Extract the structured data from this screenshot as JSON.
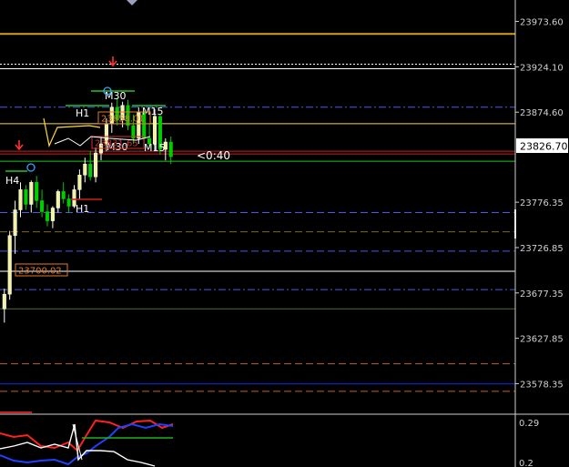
{
  "chart_data": [
    {
      "type": "candlestick",
      "title": "",
      "ylim": [
        23548.0,
        23993.0
      ],
      "y_ticks": [
        "23973.60",
        "23924.10",
        "23874.60",
        "23776.35",
        "23726.85",
        "23677.35",
        "23627.85",
        "23578.35"
      ],
      "current_price": "23826.70",
      "countdown": "<0:40",
      "colors": {
        "background": "#000000",
        "bull_candle": "#ffffff",
        "bull_candle_small": "#f3f3a0",
        "bear_candle": "#00cc00",
        "grid_line": "#2a2ad0",
        "price_label_bg": "#ffffff",
        "price_label_text": "#000000"
      },
      "horizontal_levels": [
        {
          "value": 23960.0,
          "color": "#d6a020",
          "style": "solid"
        },
        {
          "value": 23927.0,
          "color": "#ffffff",
          "style": "dotted"
        },
        {
          "value": 23922.0,
          "color": "#ffffff",
          "style": "solid"
        },
        {
          "value": 23880.0,
          "color": "#4c58e8",
          "style": "dashdot"
        },
        {
          "value": 23862.0,
          "color": "#ffd740",
          "style": "solid"
        },
        {
          "value": 23832.0,
          "color": "#cc2020",
          "style": "solid"
        },
        {
          "value": 23829.0,
          "color": "#cc2020",
          "style": "solid"
        },
        {
          "value": 23821.0,
          "color": "#21c621",
          "style": "solid"
        },
        {
          "value": 23765.0,
          "color": "#4c58e8",
          "style": "dashed"
        },
        {
          "value": 23744.0,
          "color": "#7a6a20",
          "style": "dashed"
        },
        {
          "value": 23723.0,
          "color": "#4c58e8",
          "style": "dashed"
        },
        {
          "value": 23701.0,
          "color": "#ffffff",
          "style": "solid"
        },
        {
          "value": 23681.0,
          "color": "#4c58e8",
          "style": "dashdot"
        },
        {
          "value": 23660.0,
          "color": "#506a30",
          "style": "solid"
        },
        {
          "value": 23600.0,
          "color": "#c06020",
          "style": "dashed"
        },
        {
          "value": 23578.0,
          "color": "#1a2ae8",
          "style": "solid"
        },
        {
          "value": 23570.0,
          "color": "#c06020",
          "style": "dashed"
        }
      ],
      "candles": [
        {
          "o": 23660,
          "h": 23682,
          "l": 23645,
          "c": 23676
        },
        {
          "o": 23676,
          "h": 23745,
          "l": 23670,
          "c": 23740
        },
        {
          "o": 23740,
          "h": 23778,
          "l": 23720,
          "c": 23768
        },
        {
          "o": 23768,
          "h": 23798,
          "l": 23760,
          "c": 23790
        },
        {
          "o": 23790,
          "h": 23795,
          "l": 23768,
          "c": 23774
        },
        {
          "o": 23774,
          "h": 23800,
          "l": 23765,
          "c": 23798
        },
        {
          "o": 23798,
          "h": 23805,
          "l": 23770,
          "c": 23778
        },
        {
          "o": 23778,
          "h": 23790,
          "l": 23760,
          "c": 23766
        },
        {
          "o": 23766,
          "h": 23774,
          "l": 23750,
          "c": 23756
        },
        {
          "o": 23756,
          "h": 23772,
          "l": 23748,
          "c": 23770
        },
        {
          "o": 23770,
          "h": 23790,
          "l": 23765,
          "c": 23788
        },
        {
          "o": 23788,
          "h": 23798,
          "l": 23775,
          "c": 23780
        },
        {
          "o": 23780,
          "h": 23785,
          "l": 23765,
          "c": 23772
        },
        {
          "o": 23772,
          "h": 23795,
          "l": 23770,
          "c": 23790
        },
        {
          "o": 23790,
          "h": 23812,
          "l": 23780,
          "c": 23806
        },
        {
          "o": 23806,
          "h": 23825,
          "l": 23798,
          "c": 23818
        },
        {
          "o": 23818,
          "h": 23832,
          "l": 23800,
          "c": 23804
        },
        {
          "o": 23804,
          "h": 23836,
          "l": 23798,
          "c": 23830
        },
        {
          "o": 23830,
          "h": 23848,
          "l": 23822,
          "c": 23840
        },
        {
          "o": 23840,
          "h": 23868,
          "l": 23832,
          "c": 23862
        },
        {
          "o": 23862,
          "h": 23885,
          "l": 23852,
          "c": 23880
        },
        {
          "o": 23880,
          "h": 23890,
          "l": 23860,
          "c": 23866
        },
        {
          "o": 23866,
          "h": 23886,
          "l": 23858,
          "c": 23882
        },
        {
          "o": 23882,
          "h": 23888,
          "l": 23855,
          "c": 23860
        },
        {
          "o": 23860,
          "h": 23872,
          "l": 23840,
          "c": 23846
        },
        {
          "o": 23846,
          "h": 23880,
          "l": 23840,
          "c": 23874
        },
        {
          "o": 23874,
          "h": 23876,
          "l": 23840,
          "c": 23846
        },
        {
          "o": 23846,
          "h": 23862,
          "l": 23835,
          "c": 23840
        },
        {
          "o": 23840,
          "h": 23878,
          "l": 23832,
          "c": 23870
        },
        {
          "o": 23870,
          "h": 23872,
          "l": 23828,
          "c": 23834
        },
        {
          "o": 23834,
          "h": 23846,
          "l": 23822,
          "c": 23842
        },
        {
          "o": 23842,
          "h": 23848,
          "l": 23818,
          "c": 23826
        }
      ],
      "price_boxes": [
        {
          "value": 23858.01,
          "label": "23858.01",
          "color": "#e07a2a"
        },
        {
          "value": 23830.0,
          "label": "23831.65",
          "color": "#cc3333"
        },
        {
          "value": 23700.02,
          "label": "23700.02",
          "color": "#e07a2a"
        }
      ],
      "timeframe_labels": [
        "H4",
        "H1",
        "M30",
        "M15",
        "H1",
        "M30",
        "M15"
      ],
      "indicator": {
        "y_ticks": [
          "0.29",
          "0.2"
        ],
        "colors": {
          "red": "#ff2020",
          "blue": "#2040ff",
          "white": "#ffffff",
          "green": "#20b020",
          "signal": "#c8c800"
        }
      }
    }
  ]
}
